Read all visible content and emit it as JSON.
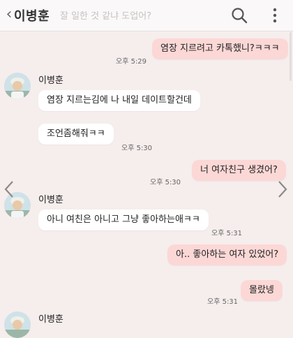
{
  "header": {
    "title": "이병훈",
    "ghost_text": "잘 일한 것 같냐 도업어?",
    "back_icon": "chevron-left-icon",
    "search_icon": "search-icon",
    "more_icon": "more-vertical-icon"
  },
  "messages": [
    {
      "direction": "out",
      "text": "염장 지르려고 카톡했니?ㅋㅋㅋ",
      "time": "오후 5:29"
    },
    {
      "direction": "in",
      "sender": "이병훈",
      "text": "염장 지르는김에 나 내일 데이트할건데"
    },
    {
      "direction": "in",
      "text": "조언좀해줘ㅋㅋ",
      "time": "오후 5:30"
    },
    {
      "direction": "out",
      "text": "너 여자친구 생겼어?",
      "time": "오후 5:30"
    },
    {
      "direction": "in",
      "sender": "이병훈",
      "text": "아니 여친은 아니고 그냥 좋아하는애ㅋㅋ",
      "time": "오후 5:31"
    },
    {
      "direction": "out",
      "text": "아.. 좋아하는 여자 있었어?"
    },
    {
      "direction": "out",
      "text": "몰랐넹",
      "time": "오후 5:31"
    },
    {
      "direction": "in",
      "sender": "이병훈"
    }
  ],
  "nav": {
    "prev_icon": "chevron-left-icon",
    "next_icon": "chevron-right-icon"
  },
  "colors": {
    "background": "#f6eded",
    "outgoing_bubble": "#fbd8d6",
    "incoming_bubble": "#ffffff"
  }
}
